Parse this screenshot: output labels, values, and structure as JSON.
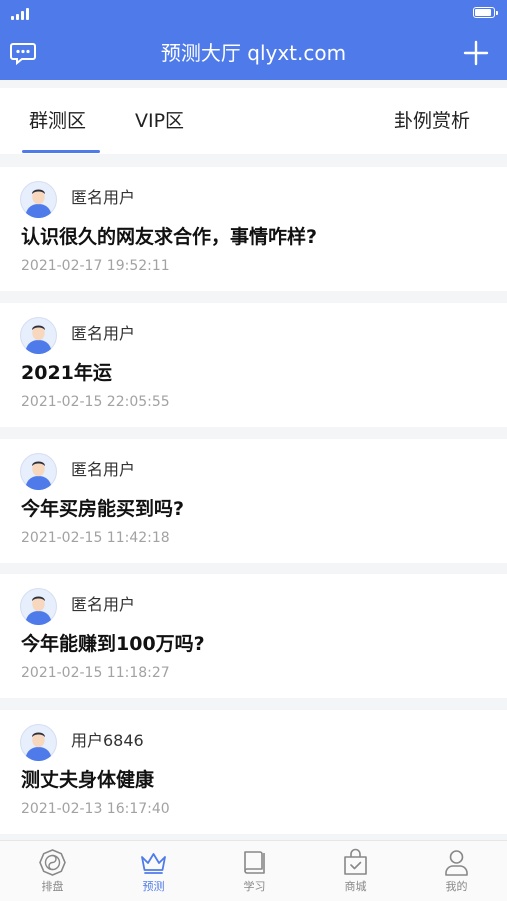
{
  "header": {
    "title": "预测大厅 qlyxt.com",
    "background": "#4f7bea"
  },
  "tabs": [
    {
      "label": "群测区",
      "active": true
    },
    {
      "label": "VIP区",
      "active": false
    },
    {
      "label": "卦例赏析",
      "active": false
    }
  ],
  "posts": [
    {
      "user": "匿名用户",
      "title": "认识很久的网友求合作，事情咋样?",
      "date": "2021-02-17 19:52:11"
    },
    {
      "user": "匿名用户",
      "title": "2021年运",
      "date": "2021-02-15 22:05:55"
    },
    {
      "user": "匿名用户",
      "title": "今年买房能买到吗?",
      "date": "2021-02-15 11:42:18"
    },
    {
      "user": "匿名用户",
      "title": "今年能赚到100万吗?",
      "date": "2021-02-15 11:18:27"
    },
    {
      "user": "用户6846",
      "title": "测丈夫身体健康",
      "date": "2021-02-13 16:17:40"
    }
  ],
  "nav": [
    {
      "label": "排盘",
      "icon": "bagua-icon",
      "active": false
    },
    {
      "label": "预测",
      "icon": "crown-icon",
      "active": true
    },
    {
      "label": "学习",
      "icon": "book-icon",
      "active": false
    },
    {
      "label": "商城",
      "icon": "shopping-bag-icon",
      "active": false
    },
    {
      "label": "我的",
      "icon": "person-icon",
      "active": false
    }
  ],
  "colors": {
    "accent": "#4f7bea",
    "date_text": "#a2a2a2",
    "nav_inactive": "#888888"
  }
}
